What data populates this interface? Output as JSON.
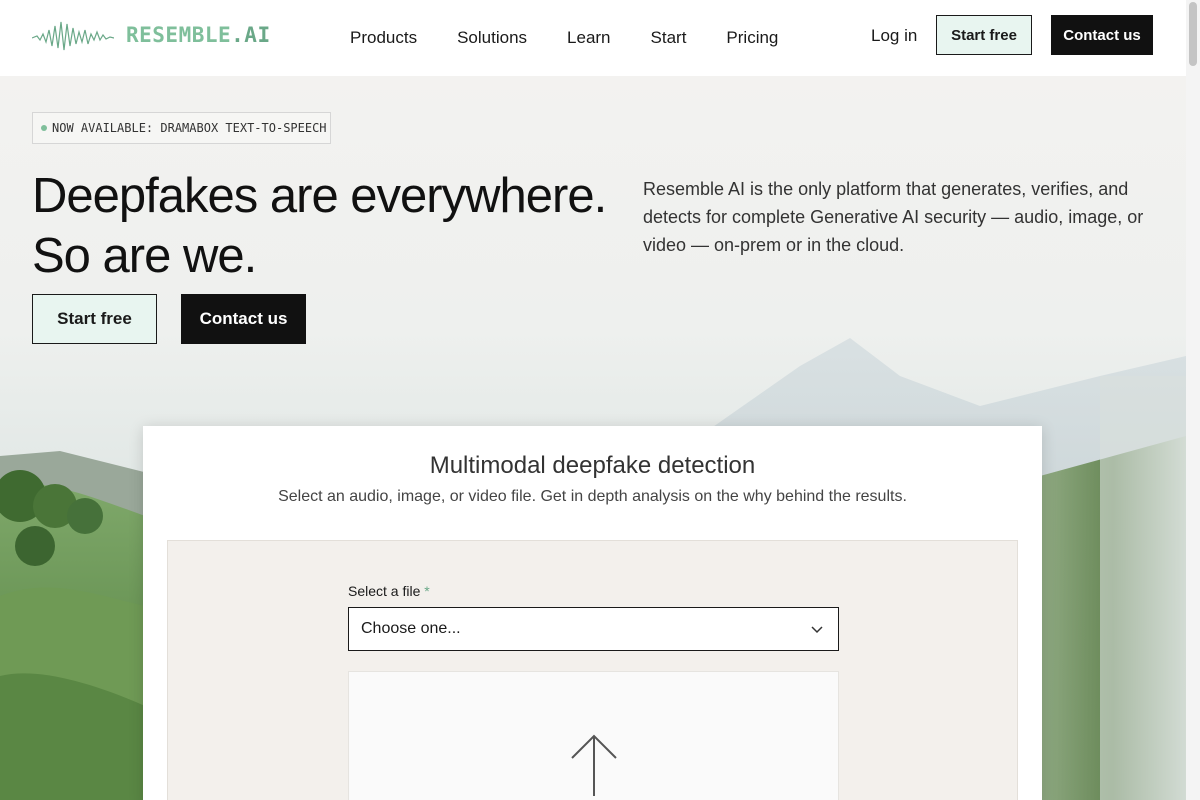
{
  "nav": {
    "logo_text": "RESEMBLE",
    "logo_suffix": ".AI",
    "links": [
      "Products",
      "Solutions",
      "Learn",
      "Start",
      "Pricing"
    ],
    "login": "Log in",
    "start_free": "Start free",
    "contact": "Contact us"
  },
  "hero": {
    "badge": "NOW AVAILABLE: DRAMABOX TEXT-TO-SPEECH",
    "headline_line1": "Deepfakes are everywhere.",
    "headline_line2": "So are we.",
    "description": "Resemble AI is the only platform that generates, verifies, and detects for complete Generative AI security — audio, image, or video — on-prem or in the cloud.",
    "start_free": "Start free",
    "contact": "Contact us"
  },
  "detector": {
    "title": "Multimodal deepfake detection",
    "subtitle": "Select an audio, image, or video file. Get in depth analysis on the why behind the results.",
    "file_label": "Select a file",
    "required_mark": "*",
    "select_value": "Choose one..."
  },
  "colors": {
    "accent": "#7fbf9b",
    "light_button": "#e8f5f0",
    "dark_button": "#111111",
    "panel": "#f3f0ec"
  }
}
